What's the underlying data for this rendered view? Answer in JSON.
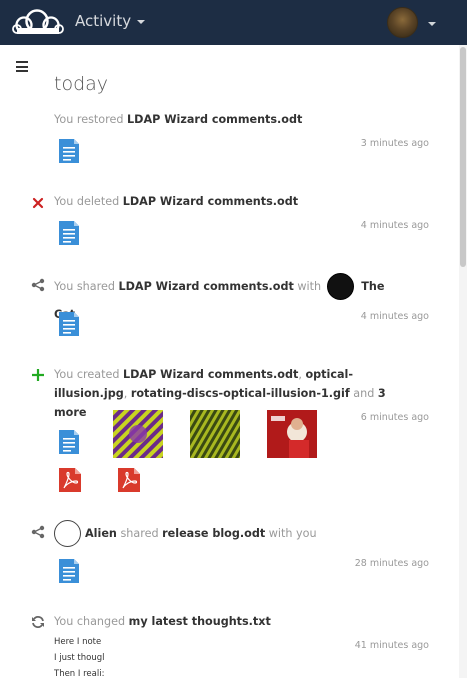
{
  "header": {
    "app_name": "Activity"
  },
  "day_title": "today",
  "entries": [
    {
      "prefix": "You restored ",
      "file": "LDAP Wizard comments.odt",
      "time": "3 minutes ago"
    },
    {
      "prefix": "You deleted ",
      "file": "LDAP Wizard comments.odt",
      "time": "4 minutes ago"
    },
    {
      "prefix": "You shared ",
      "file": "LDAP Wizard comments.odt",
      "mid": " with ",
      "user": "The Cat",
      "time": "4 minutes ago"
    },
    {
      "prefix": "You created ",
      "file1": "LDAP Wizard comments.odt",
      "sep1": ", ",
      "file2": "optical-illusion.jpg",
      "sep2": ",",
      "file3": "rotating-discs-optical-illusion-1.gif",
      "and": " and ",
      "more": "3 more",
      "time": "6 minutes ago"
    },
    {
      "user": "Alien",
      "mid": " shared ",
      "file": "release blog.odt",
      "suffix": " with you",
      "time": "28 minutes ago"
    },
    {
      "prefix": "You changed ",
      "file": "my latest thoughts.txt",
      "time": "41 minutes ago",
      "preview": [
        "Here I note",
        "I just thougl",
        "Then I reali:"
      ]
    }
  ],
  "colors": {
    "header_bg": "#1d2d44",
    "doc_blue": "#3a8fd8",
    "pdf_red": "#d93a2c",
    "deleted": "#cc2222",
    "created": "#22aa22"
  }
}
